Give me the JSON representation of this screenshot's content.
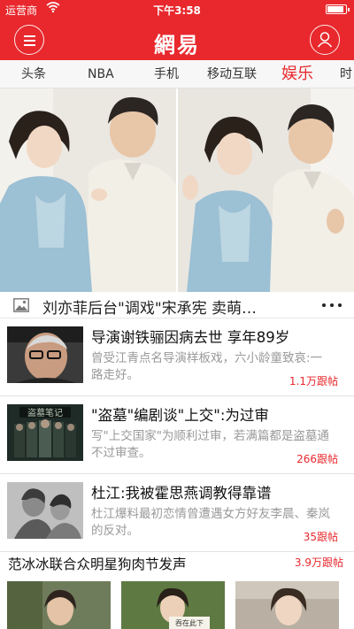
{
  "status_bar": {
    "carrier": "运营商",
    "time": "下午3:58",
    "battery_level": 0.9
  },
  "header": {
    "logo": "網易",
    "accent_color": "#e8282d",
    "menu_icon": "hamburger-menu-icon",
    "user_icon": "user-profile-icon"
  },
  "tabs": [
    {
      "label": "头条"
    },
    {
      "label": "NBA"
    },
    {
      "label": "手机"
    },
    {
      "label": "移动互联"
    },
    {
      "label": "娱乐",
      "active": true
    },
    {
      "label": "时"
    }
  ],
  "hero": {
    "caption": "刘亦菲后台\"调戏\"宋承宪 卖萌…",
    "icon": "gallery-icon",
    "more_icon": "more-dots-icon"
  },
  "news": [
    {
      "title": "导演谢铁骊因病去世 享年89岁",
      "desc": "曾受江青点名导演样板戏，六小龄童致哀:一路走好。",
      "count": "1.1万跟帖"
    },
    {
      "title": "\"盗墓\"编剧谈\"上交\":为过审",
      "desc": "写\"上交国家\"为顺利过审，若满篇都是盗墓通不过审查。",
      "count": "266跟帖"
    },
    {
      "title": "杜江:我被霍思燕调教得靠谱",
      "desc": "杜江爆料最初恋情曾遭遇女方好友李晨、秦岚的反对。",
      "count": "35跟帖"
    }
  ],
  "topic": {
    "title": "范冰冰联合众明星狗肉节发声",
    "count": "3.9万跟帖"
  }
}
